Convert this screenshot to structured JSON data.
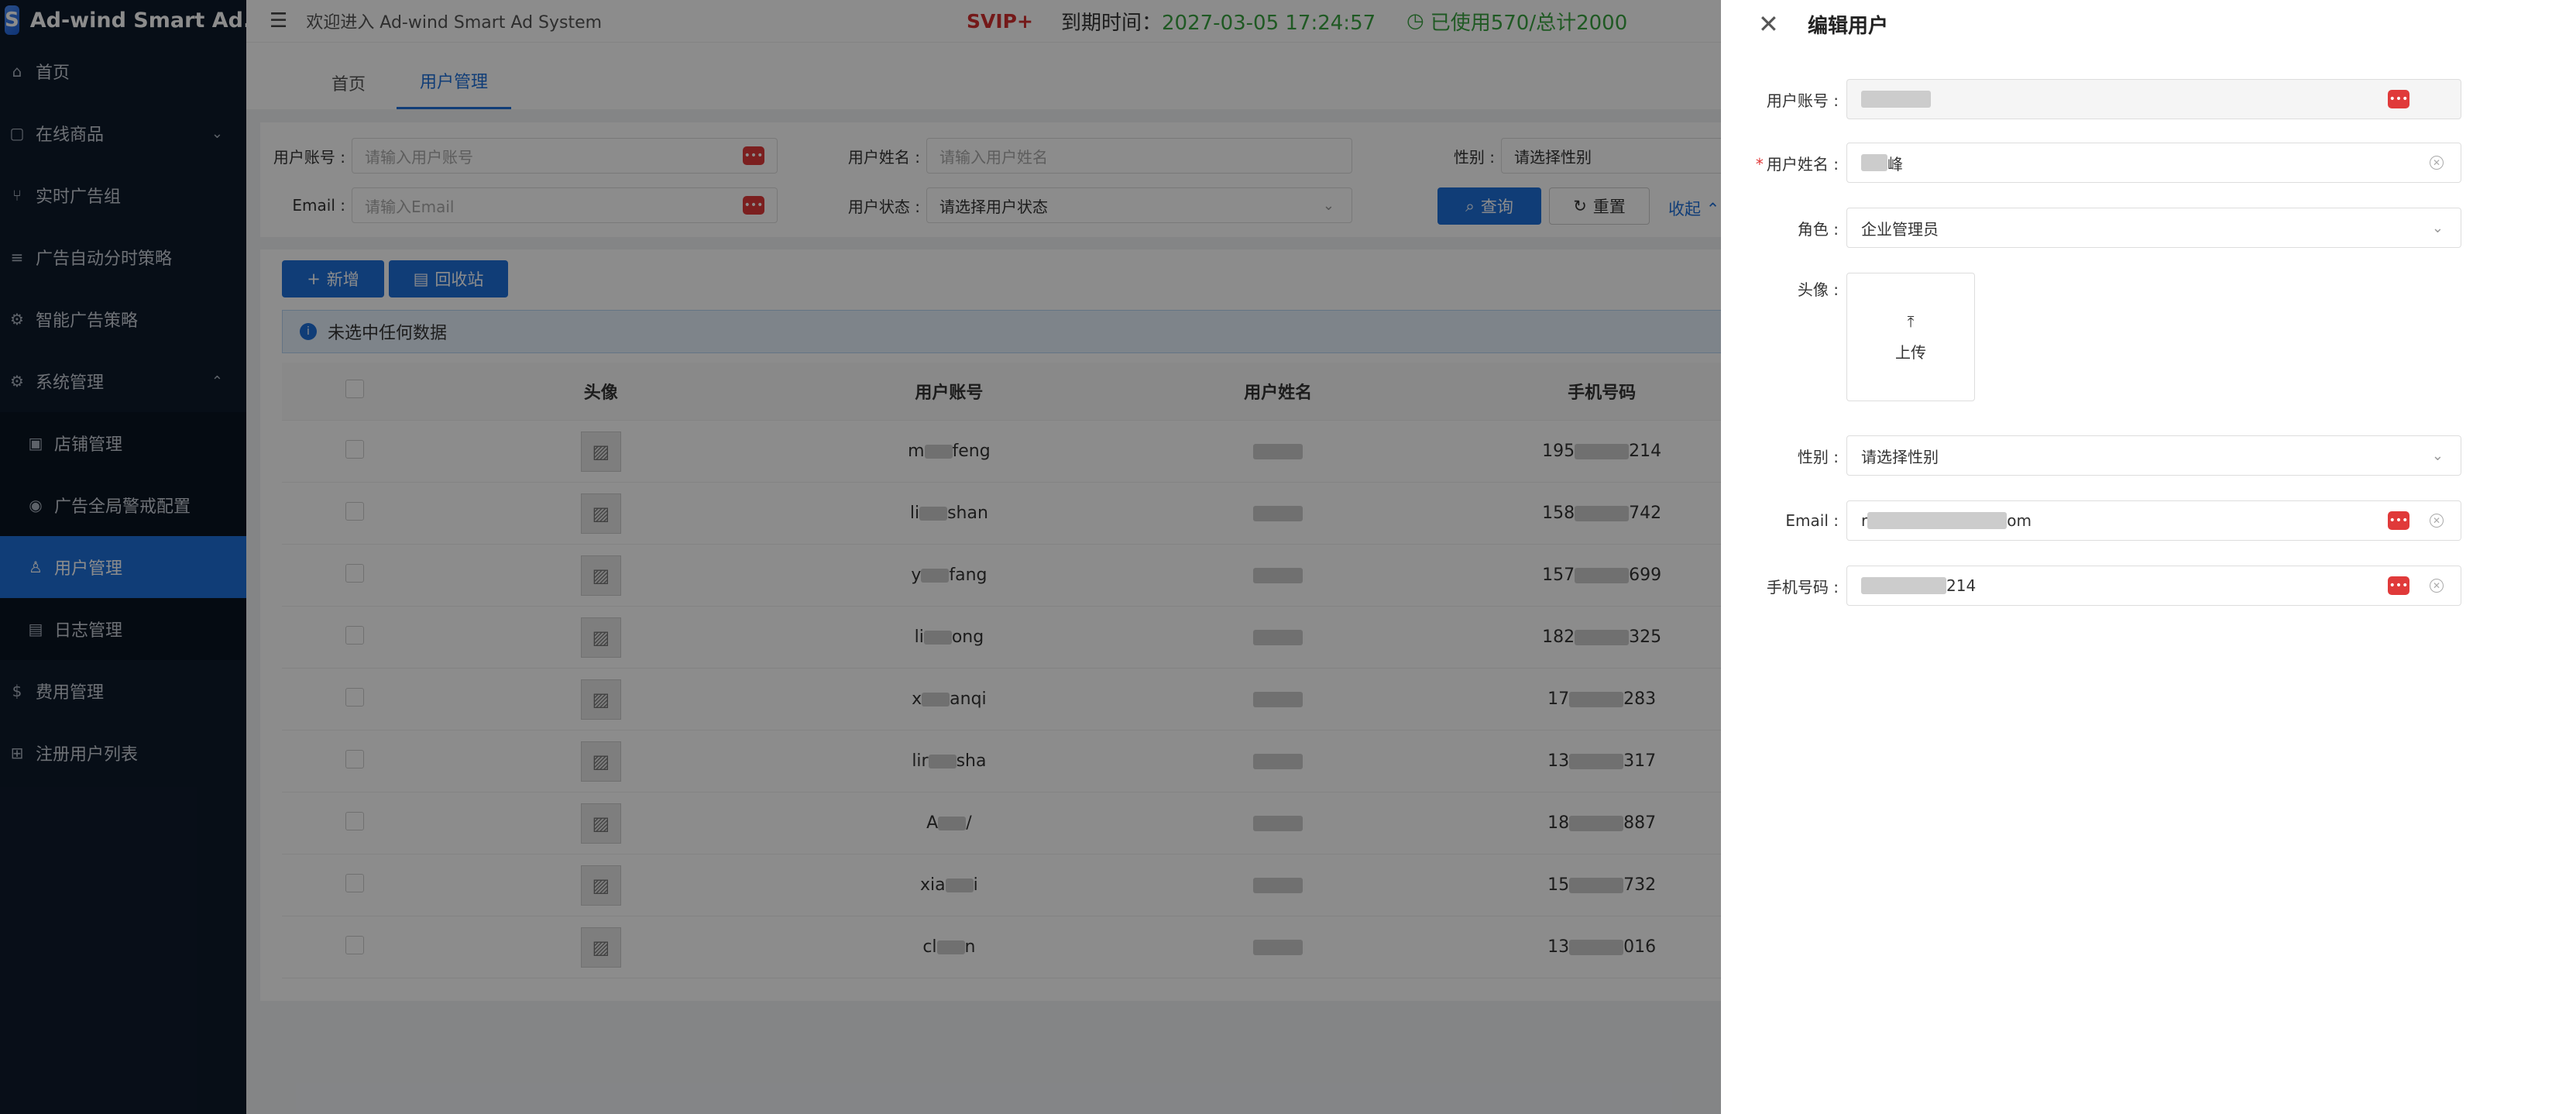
{
  "app": {
    "title": "Ad-wind Smart Ad..."
  },
  "sidebar": {
    "items": [
      {
        "label": "首页",
        "icon": "home-icon"
      },
      {
        "label": "在线商品",
        "icon": "bag-icon"
      },
      {
        "label": "实时广告组",
        "icon": "branch-icon"
      },
      {
        "label": "广告自动分时策略",
        "icon": "list-icon"
      },
      {
        "label": "智能广告策略",
        "icon": "gear-icon"
      },
      {
        "label": "系统管理",
        "icon": "settings-icon"
      }
    ],
    "submenu": [
      {
        "label": "店铺管理",
        "icon": "shop-icon"
      },
      {
        "label": "广告全局警戒配置",
        "icon": "eye-icon"
      },
      {
        "label": "用户管理",
        "icon": "user-icon"
      },
      {
        "label": "日志管理",
        "icon": "log-icon"
      }
    ],
    "bottom": [
      {
        "label": "费用管理",
        "icon": "dollar-icon"
      },
      {
        "label": "注册用户列表",
        "icon": "grid-icon"
      }
    ]
  },
  "topbar": {
    "welcome": "欢迎进入 Ad-wind Smart Ad System",
    "svip": "SVIP+",
    "expire_label": "到期时间：",
    "expire_value": "2027-03-05 17:24:57",
    "usage": "已使用570/总计2000"
  },
  "tabs": [
    {
      "label": "首页"
    },
    {
      "label": "用户管理"
    }
  ],
  "search": {
    "account_label": "用户账号 :",
    "account_placeholder": "请输入用户账号",
    "name_label": "用户姓名 :",
    "name_placeholder": "请输入用户姓名",
    "gender_label": "性别 :",
    "gender_placeholder": "请选择性别",
    "email_label": "Email :",
    "email_placeholder": "请输入Email",
    "status_label": "用户状态 :",
    "status_placeholder": "请选择用户状态",
    "query_button": "查询",
    "reset_button": "重置",
    "collapse_link": "收起"
  },
  "actions": {
    "add_button": "新增",
    "recycle_button": "回收站"
  },
  "alert": {
    "text": "未选中任何数据"
  },
  "table": {
    "columns": [
      "头像",
      "用户账号",
      "用户姓名",
      "手机号码"
    ],
    "rows": [
      {
        "account_a": "m",
        "account_b": "feng",
        "phone_a": "195",
        "phone_b": "214"
      },
      {
        "account_a": "li",
        "account_b": "shan",
        "phone_a": "158",
        "phone_b": "742"
      },
      {
        "account_a": "y",
        "account_b": "fang",
        "phone_a": "157",
        "phone_b": "699"
      },
      {
        "account_a": "li",
        "account_b": "ong",
        "phone_a": "182",
        "phone_b": "325"
      },
      {
        "account_a": "x",
        "account_b": "anqi",
        "phone_a": "17",
        "phone_b": "283"
      },
      {
        "account_a": "lir",
        "account_b": "sha",
        "phone_a": "13",
        "phone_b": "317"
      },
      {
        "account_a": "A",
        "account_b": "/",
        "phone_a": "18",
        "phone_b": "887"
      },
      {
        "account_a": "xia",
        "account_b": "i",
        "phone_a": "15",
        "phone_b": "732"
      },
      {
        "account_a": "cl",
        "account_b": "n",
        "phone_a": "13",
        "phone_b": "016"
      }
    ]
  },
  "drawer": {
    "title": "编辑用户",
    "account_label": "用户账号 :",
    "name_label": "用户姓名 :",
    "name_value_suffix": "峰",
    "role_label": "角色 :",
    "role_value": "企业管理员",
    "avatar_label": "头像 :",
    "upload_label": "上传",
    "gender_label": "性别 :",
    "gender_placeholder": "请选择性别",
    "email_label": "Email :",
    "email_value_prefix": "r",
    "email_value_suffix": "om",
    "phone_label": "手机号码 :",
    "phone_value_suffix": "214"
  }
}
